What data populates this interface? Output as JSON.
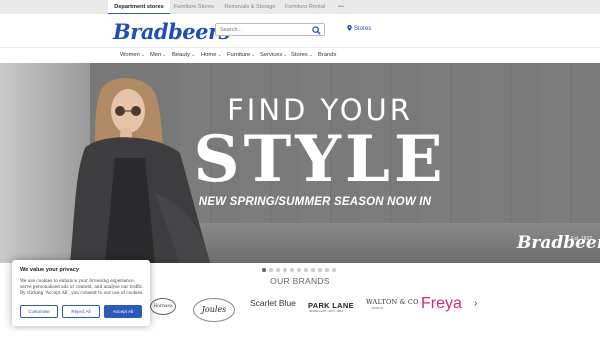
{
  "topbar": {
    "tabs": [
      {
        "label": "Department stores",
        "active": true
      },
      {
        "label": "Furniture Stores",
        "active": false
      },
      {
        "label": "Removals & Storage",
        "active": false
      },
      {
        "label": "Furniture Rental",
        "active": false
      },
      {
        "label": "•••",
        "active": false
      }
    ]
  },
  "header": {
    "logo": "Bradbeers",
    "search_placeholder": "Search...",
    "stores_label": "Stores"
  },
  "nav": {
    "items": [
      {
        "label": "Women",
        "chevron": true
      },
      {
        "label": "Men",
        "chevron": true
      },
      {
        "label": "Beauty",
        "chevron": true
      },
      {
        "label": "Home",
        "chevron": true
      },
      {
        "label": "Furniture",
        "chevron": true
      },
      {
        "label": "Services",
        "chevron": true
      },
      {
        "label": "Stores",
        "chevron": true
      },
      {
        "label": "Brands",
        "chevron": false
      }
    ]
  },
  "hero": {
    "title_line1": "FIND YOUR",
    "title_line2": "STYLE",
    "subtitle": "NEW SPRING/SUMMER SEASON NOW IN",
    "brand_mark": "Bradbeers",
    "established": "Est. 1837"
  },
  "carousel": {
    "slide_count": 11,
    "active_index": 0
  },
  "brands": {
    "title": "OUR BRANDS",
    "logos": [
      "Hornsea",
      "Joules",
      "Scarlet Blue",
      "PARK LANE",
      "WALTON & CO",
      "Freya"
    ],
    "park_lane_sub": "JEWELLERY | EST. 1964",
    "walton_sub": "DUBLIN"
  },
  "cookie": {
    "title": "We value your privacy",
    "body": "We use cookies to enhance your browsing experience, serve personalised ads or content, and analyse our traffic. By clicking 'Accept All', you consent to our use of cookies.",
    "customise": "Customise",
    "reject": "Reject All",
    "accept": "Accept All"
  },
  "colors": {
    "brand": "#1f4fb0",
    "freya": "#d42582"
  }
}
